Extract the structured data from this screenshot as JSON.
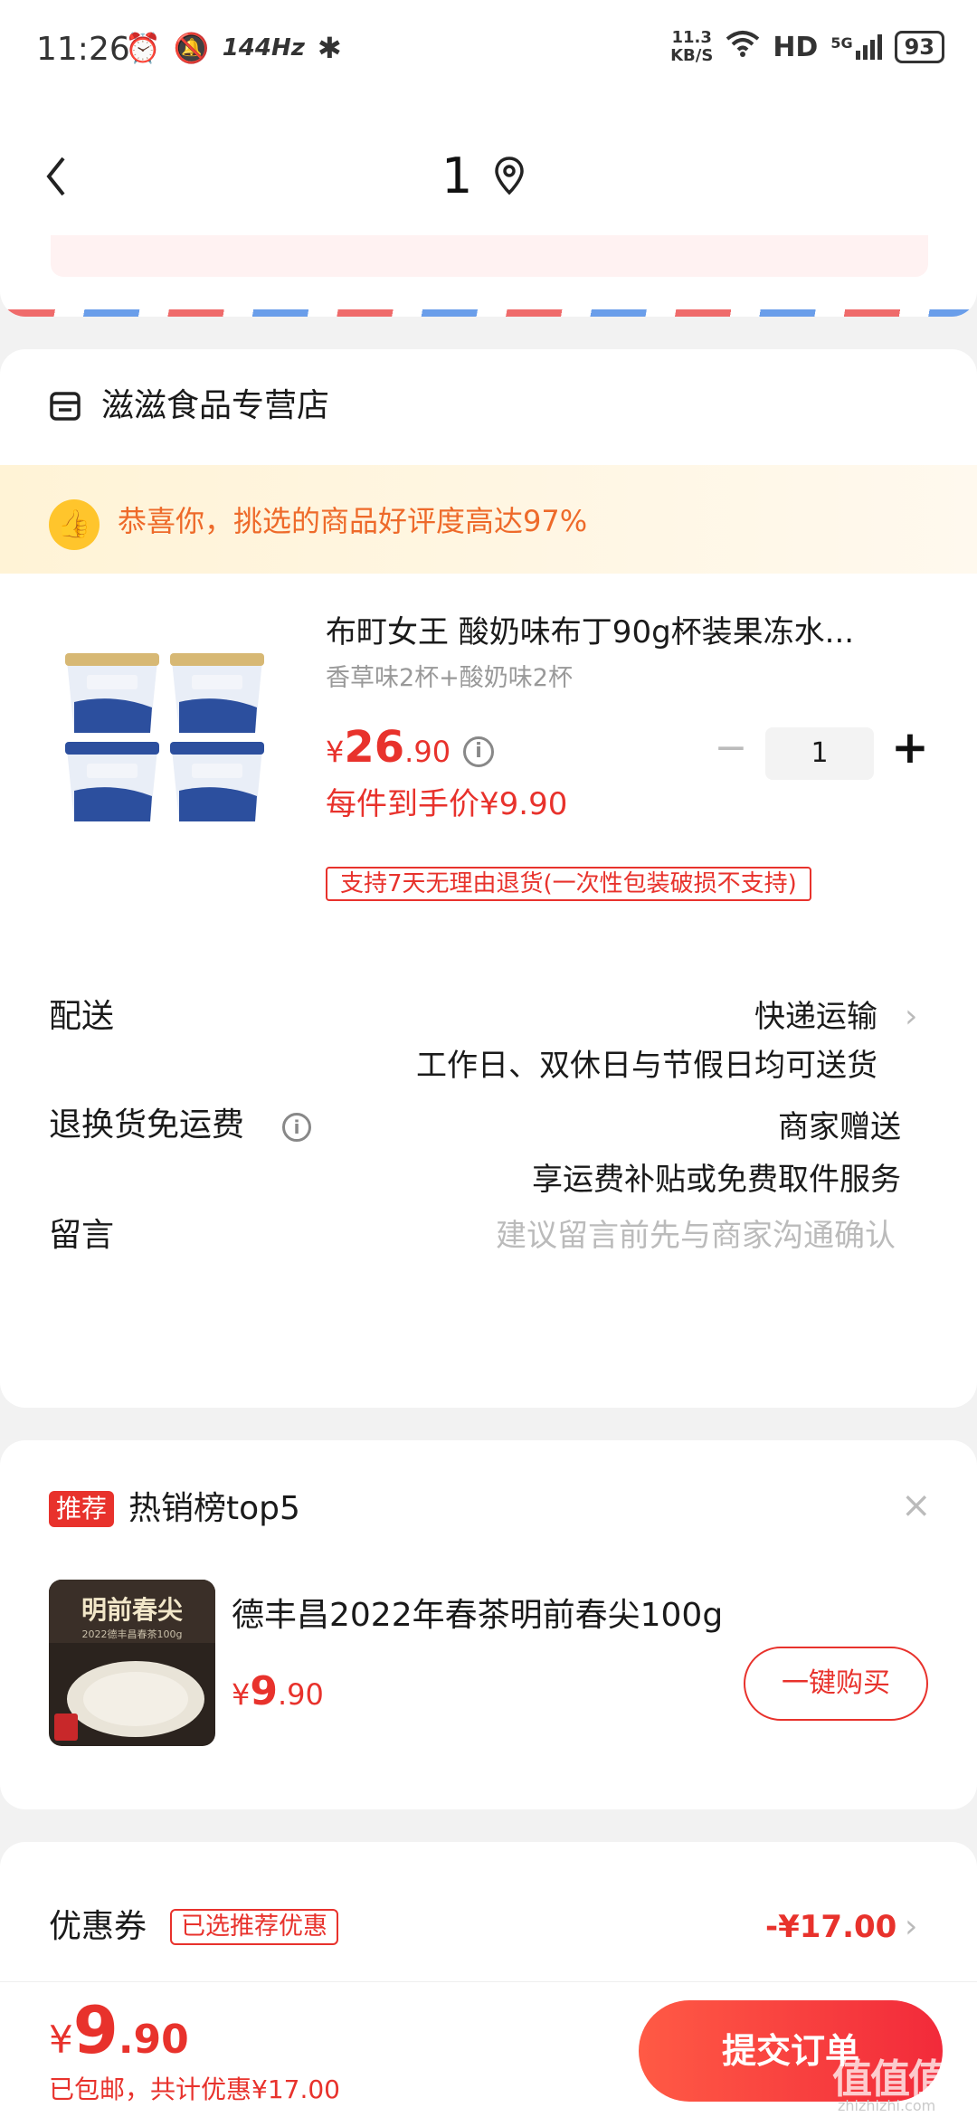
{
  "status_bar": {
    "time": "11:26",
    "refresh_rate": "144Hz",
    "net_speed_value": "11.3",
    "net_speed_unit": "KB/S",
    "hd": "HD",
    "network": "5G",
    "battery": "93"
  },
  "header": {
    "address_number": "1"
  },
  "store": {
    "name": "滋滋食品专营店",
    "praise_text": "恭喜你，挑选的商品好评度高达97%"
  },
  "product": {
    "title": "布町女王 酸奶味布丁90g杯装果冻水...",
    "spec": "香草味2杯+酸奶味2杯",
    "price_currency": "¥",
    "price_integer": "26",
    "price_decimal": ".90",
    "quantity": "1",
    "minus_symbol": "−",
    "plus_symbol": "+",
    "unit_price": "每件到手价¥9.90",
    "return_tag": "支持7天无理由退货(一次性包装破损不支持)"
  },
  "delivery": {
    "label": "配送",
    "value": "快递运输",
    "note": "工作日、双休日与节假日均可送货"
  },
  "return_shipping": {
    "label": "退换货免运费",
    "value": "商家赠送",
    "note": "享运费补贴或免费取件服务"
  },
  "message": {
    "label": "留言",
    "placeholder": "建议留言前先与商家沟通确认"
  },
  "recommend": {
    "badge": "推荐",
    "title": "热销榜top5",
    "close_symbol": "×",
    "item_name": "德丰昌2022年春茶明前春尖100g",
    "image_text": "明前春尖",
    "image_subtext": "2022德丰昌春茶100g",
    "price_currency": "¥",
    "price_integer": "9",
    "price_decimal": ".90",
    "buy_label": "一键购买"
  },
  "coupon": {
    "label": "优惠券",
    "tag": "已选推荐优惠",
    "value": "-¥17.00"
  },
  "bottom": {
    "price_currency": "¥",
    "price_integer": "9",
    "price_decimal": ".90",
    "note": "已包邮，共计优惠¥17.00",
    "submit_label": "提交订单",
    "watermark": "值值值",
    "watermark_sub": "zhizhizhi.com"
  },
  "colors": {
    "accent": "#e8322c",
    "praise": "#ee6a2a",
    "praise_icon": "#ffc52c"
  }
}
